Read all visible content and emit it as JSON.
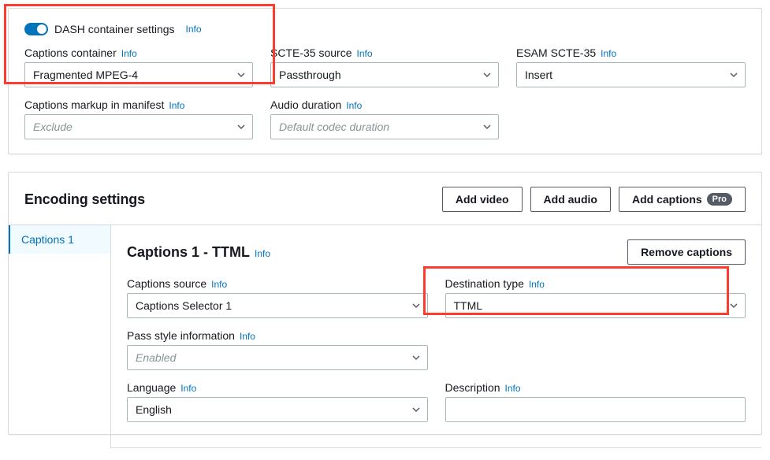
{
  "dash": {
    "toggle_label": "DASH container settings",
    "captions_container": {
      "label": "Captions container",
      "value": "Fragmented MPEG-4"
    },
    "scte35_source": {
      "label": "SCTE-35 source",
      "value": "Passthrough"
    },
    "esam_scte35": {
      "label": "ESAM SCTE-35",
      "value": "Insert"
    },
    "captions_markup": {
      "label": "Captions markup in manifest",
      "value": "Exclude"
    },
    "audio_duration": {
      "label": "Audio duration",
      "value": "Default codec duration"
    }
  },
  "encoding": {
    "heading": "Encoding settings",
    "buttons": {
      "add_video": "Add video",
      "add_audio": "Add audio",
      "add_captions": "Add captions",
      "pro": "Pro"
    },
    "nav_item": "Captions 1",
    "content": {
      "title": "Captions 1 - TTML",
      "remove": "Remove captions",
      "captions_source": {
        "label": "Captions source",
        "value": "Captions Selector 1"
      },
      "destination_type": {
        "label": "Destination type",
        "value": "TTML"
      },
      "pass_style": {
        "label": "Pass style information",
        "value": "Enabled"
      },
      "language": {
        "label": "Language",
        "value": "English"
      },
      "description": {
        "label": "Description",
        "value": ""
      }
    }
  },
  "info": "Info"
}
